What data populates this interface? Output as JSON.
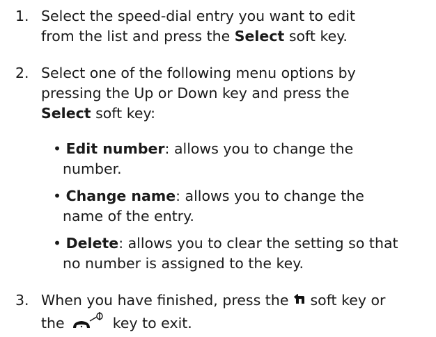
{
  "steps": [
    {
      "number": "1.",
      "line1_a": "Select the speed-dial entry you want to edit",
      "line2_a": "from the list and press the ",
      "line2_bold": "Select",
      "line2_b": " soft key."
    },
    {
      "number": "2.",
      "line1": "Select one of the following menu options by",
      "line2": "pressing the Up or Down key and press the",
      "line3_bold": "Select",
      "line3_b": " soft key:"
    },
    {
      "number": "3.",
      "line1_a": "When you have finished, press the ",
      "line1_b": " soft key or",
      "line2_a": "the ",
      "line2_b": " key to exit.",
      "back_icon": "back-arrow-icon",
      "end_icon": "end-call-power-icon"
    }
  ],
  "options": [
    {
      "bullet": "•",
      "term": "Edit number",
      "desc1": ": allows you to change the",
      "desc2": "number."
    },
    {
      "bullet": "•",
      "term": "Change name",
      "desc1": ": allows you to change the",
      "desc2": "name of the entry."
    },
    {
      "bullet": "•",
      "term": "Delete",
      "desc1": ": allows you to clear the setting so that",
      "desc2": "no number is assigned to the key."
    }
  ]
}
